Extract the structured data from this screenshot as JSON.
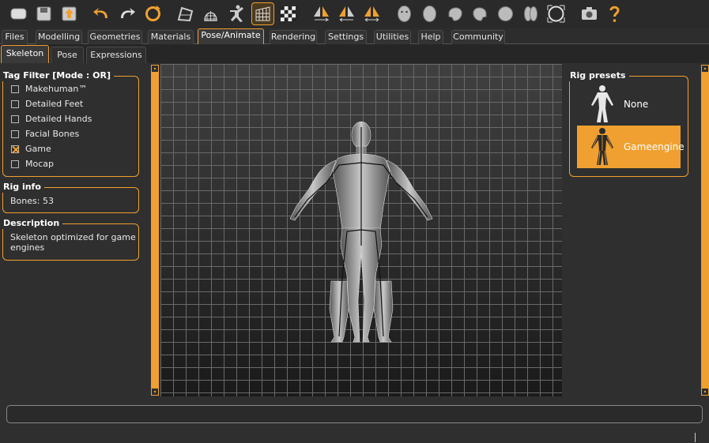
{
  "toolbar": {
    "icons": [
      "undo-all-icon",
      "save-icon",
      "export-icon",
      "undo-icon",
      "redo-icon",
      "reset-icon",
      "smooth-icon",
      "wireframe-icon",
      "pose-icon",
      "grid-icon",
      "checker-icon",
      "symmetry-right-icon",
      "symmetry-left-icon",
      "symmetry-icon",
      "front-view-icon",
      "back-view-icon",
      "left-view-icon",
      "right-view-icon",
      "top-view-icon",
      "bottom-view-icon",
      "reset-camera-icon",
      "screenshot-icon",
      "help-icon"
    ]
  },
  "top_tabs": [
    "Files",
    "Modelling",
    "Geometries",
    "Materials",
    "Pose/Animate",
    "Rendering",
    "Settings",
    "Utilities",
    "Help",
    "Community"
  ],
  "active_top_tab": "Pose/Animate",
  "sub_tabs": [
    "Skeleton",
    "Pose",
    "Expressions"
  ],
  "active_sub_tab": "Skeleton",
  "tag_filter": {
    "title": "Tag Filter [Mode : OR]",
    "items": [
      {
        "label": "Makehuman™",
        "checked": false
      },
      {
        "label": "Detailed Feet",
        "checked": false
      },
      {
        "label": "Detailed Hands",
        "checked": false
      },
      {
        "label": "Facial Bones",
        "checked": false
      },
      {
        "label": "Game",
        "checked": true
      },
      {
        "label": "Mocap",
        "checked": false
      }
    ]
  },
  "rig_info": {
    "title": "Rig info",
    "bones": "Bones: 53"
  },
  "description": {
    "title": "Description",
    "line1": "Skeleton optimized for game",
    "line2": "engines"
  },
  "rig_presets": {
    "title": "Rig presets",
    "items": [
      {
        "label": "None",
        "selected": false
      },
      {
        "line1": "Game",
        "line2": "engine",
        "selected": true
      }
    ]
  },
  "colors": {
    "accent": "#f0a030",
    "background": "#2f2f2f"
  }
}
